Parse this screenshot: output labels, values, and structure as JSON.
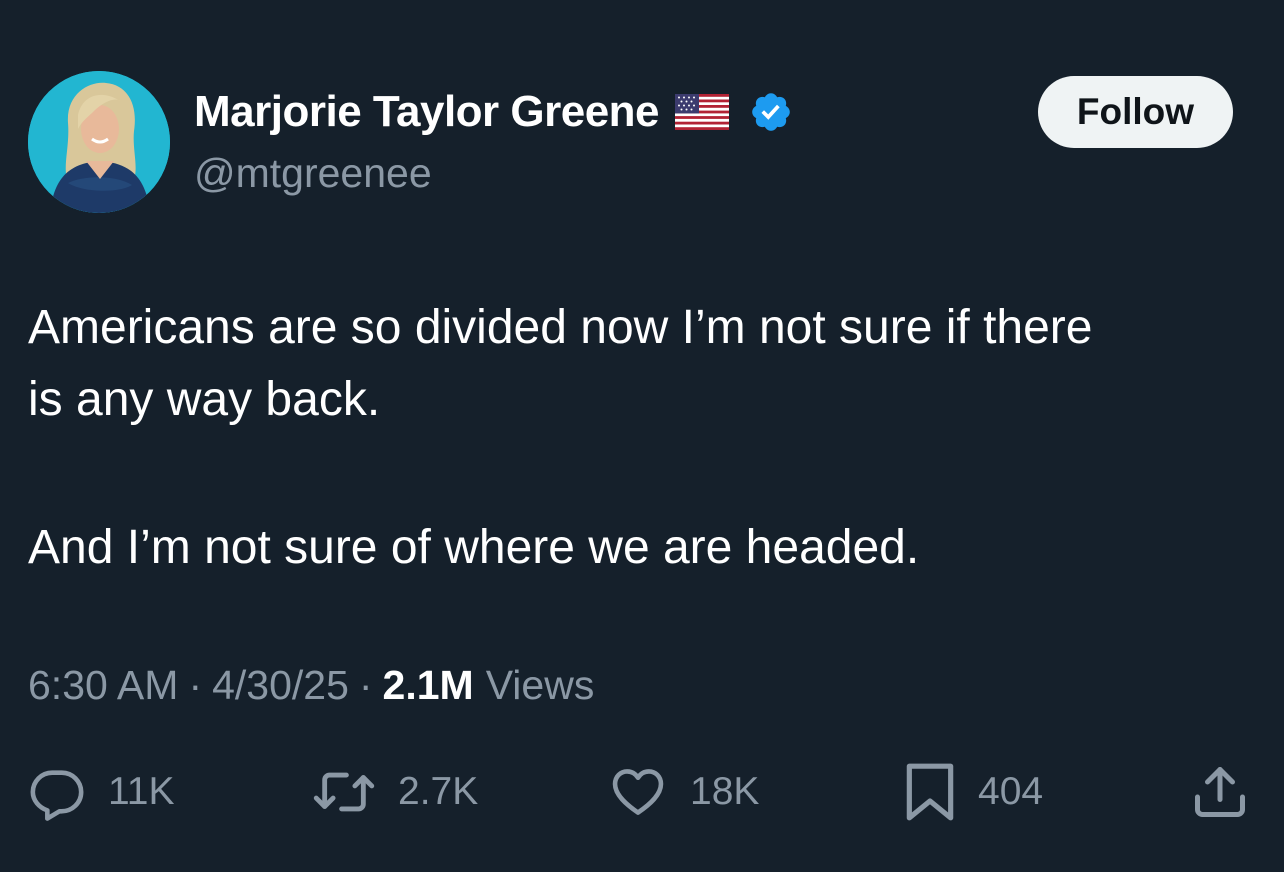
{
  "author": {
    "display_name": "Marjorie Taylor Greene",
    "handle": "@mtgreenee",
    "flag_icon": "us-flag-icon",
    "verified_icon": "verified-badge-icon",
    "verified_color": "#1d9bf0"
  },
  "follow_button": {
    "label": "Follow"
  },
  "tweet": {
    "line1": "Americans are so divided now I’m not sure if there",
    "line2": "is any way back.",
    "line3": "And I’m not sure of where we are headed."
  },
  "meta": {
    "time": "6:30 AM",
    "separator": "·",
    "date": "4/30/25",
    "views_count": "2.1M",
    "views_label": "Views"
  },
  "actions": {
    "replies": "11K",
    "retweets": "2.7K",
    "likes": "18K",
    "bookmarks": "404"
  },
  "colors": {
    "background": "#15202b",
    "secondary_text": "#8b98a5",
    "accent": "#1d9bf0"
  }
}
